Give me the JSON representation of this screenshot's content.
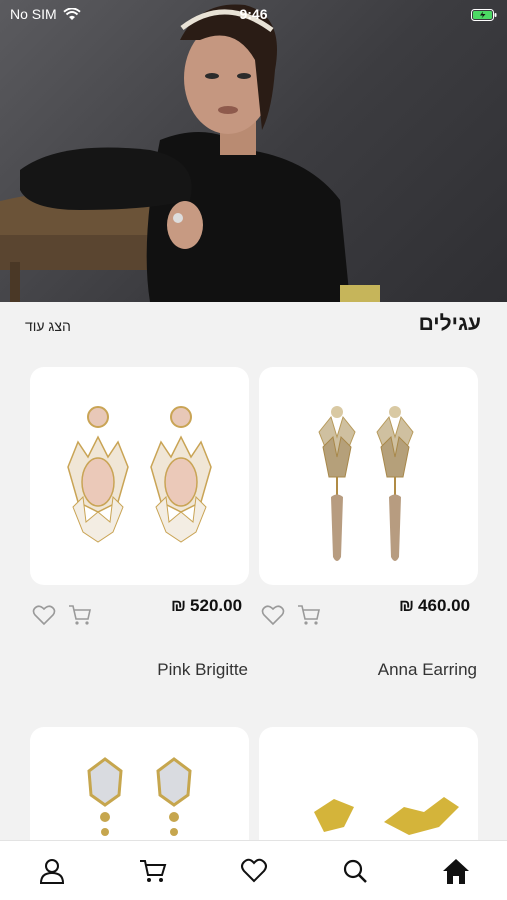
{
  "status_bar": {
    "carrier": "No SIM",
    "time": "9:46"
  },
  "hero": {
    "image": "model-with-jewelry-photo"
  },
  "section": {
    "title": "עגילים",
    "show_more": "הצג עוד"
  },
  "products": [
    {
      "name": "Anna Earring",
      "price": "460.00",
      "currency": "₪"
    },
    {
      "name": "Pink Brigitte",
      "price": "520.00",
      "currency": "₪"
    },
    {
      "name": "",
      "price": "",
      "currency": ""
    },
    {
      "name": "",
      "price": "",
      "currency": ""
    }
  ],
  "bottom_nav": [
    "home-icon",
    "search-icon",
    "heart-icon",
    "cart-icon",
    "user-icon"
  ],
  "colors": {
    "accent": "#111111",
    "background": "#f2f2f2",
    "card": "#ffffff",
    "icon_gray": "#9a9a9a"
  }
}
